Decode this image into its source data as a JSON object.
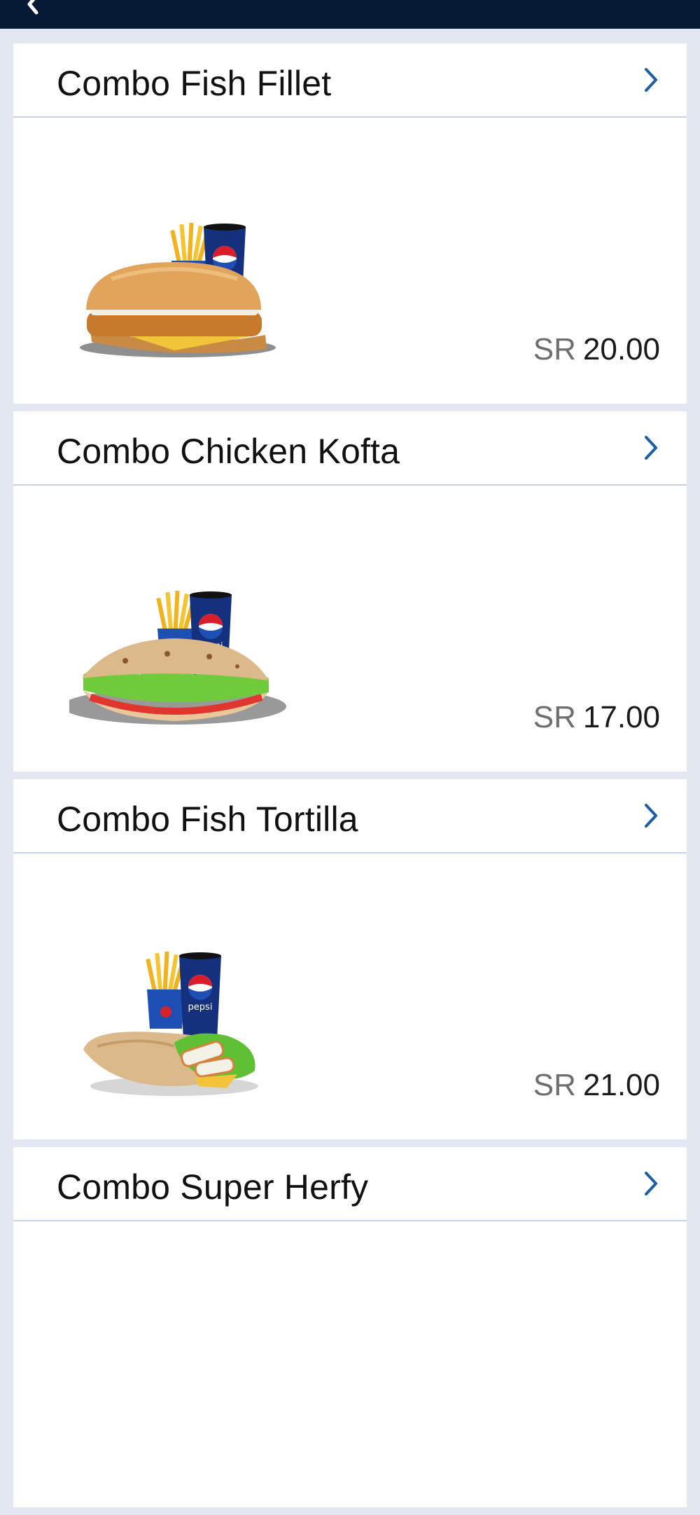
{
  "header": {
    "back_icon": "chevron-left-icon",
    "background": "#061a35"
  },
  "colors": {
    "page_background": "#e3e7f1",
    "card_background": "#ffffff",
    "chevron": "#1b5fa8",
    "divider": "#c9d3e8"
  },
  "items": [
    {
      "title": "Combo Fish Fillet",
      "currency": "SR",
      "price": "20.00",
      "image": "fish-fillet-combo-image"
    },
    {
      "title": "Combo Chicken Kofta",
      "currency": "SR",
      "price": "17.00",
      "image": "chicken-kofta-combo-image"
    },
    {
      "title": "Combo Fish Tortilla",
      "currency": "SR",
      "price": "21.00",
      "image": "fish-tortilla-combo-image"
    },
    {
      "title": "Combo Super Herfy",
      "image": "super-herfy-combo-image"
    }
  ],
  "drink_label": "pepsi"
}
